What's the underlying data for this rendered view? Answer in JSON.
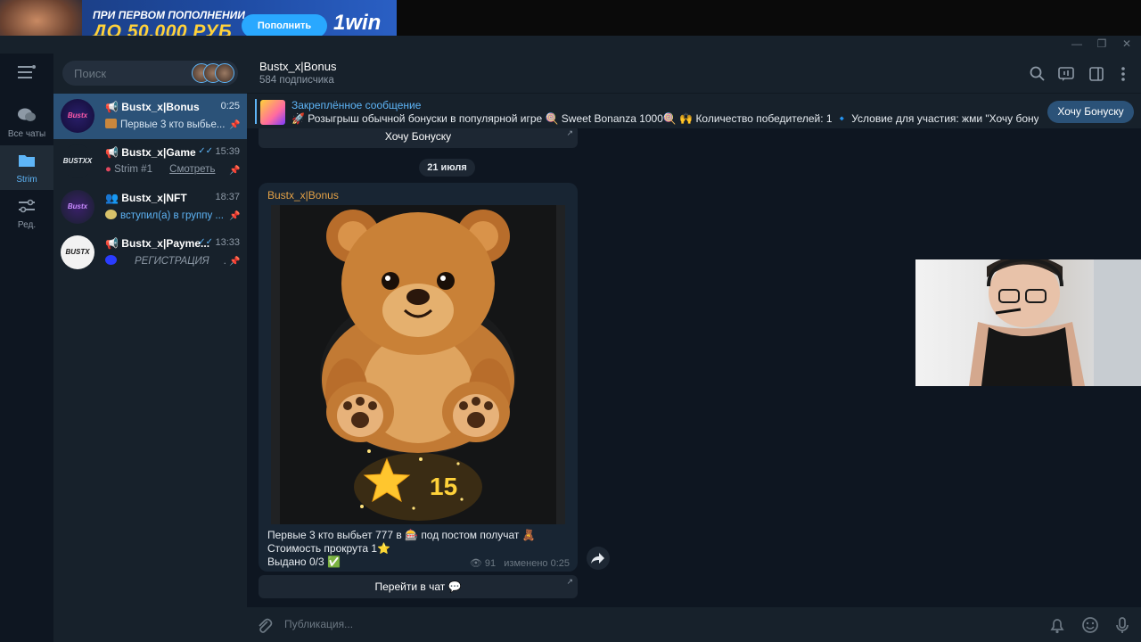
{
  "ad": {
    "line1": "ПРИ ПЕРВОМ ПОПОЛНЕНИИ",
    "line2": "ДО 50.000 РУБ",
    "button": "Пополнить",
    "logo": "1win"
  },
  "rail": {
    "items": [
      {
        "label": "Все чаты",
        "icon": "chats-icon"
      },
      {
        "label": "Strim",
        "icon": "folder-icon"
      },
      {
        "label": "Ред.",
        "icon": "edit-filters-icon"
      }
    ]
  },
  "search": {
    "placeholder": "Поиск"
  },
  "chats": [
    {
      "name": "Bustx_x|Bonus",
      "time": "0:25",
      "preview": "Первые 3 кто выбье...",
      "avatar_text": "Bustx BONUS"
    },
    {
      "name": "Bustx_x|Game",
      "time": "15:39",
      "preview": "Strim #1",
      "action": "Смотреть",
      "avatar_text": "BUSTXX"
    },
    {
      "name": "Bustx_x|NFT",
      "time": "18:37",
      "preview": "вступил(а) в группу ...",
      "avatar_text": "Bustx NFT"
    },
    {
      "name": "Bustx_x|Payme...",
      "time": "13:33",
      "preview": "РЕГИСТРАЦИЯ",
      "preview_tail": "...",
      "avatar_text": "BUSTX"
    }
  ],
  "header": {
    "title": "Bustx_x|Bonus",
    "subtitle": "584 подписчика"
  },
  "pinned": {
    "title": "Закреплённое сообщение",
    "text": "🚀 Розыгрыш обычной бонуски в популярной игре 🍭 Sweet Bonanza 1000🍭 🙌 Количество победителей: 1 🔹 Условие для участия: жми \"Хочу бонуску\" 🔘...",
    "button": "Хочу Бонуску"
  },
  "messages": {
    "top_button": "Хочу Бонуску",
    "date": "21 июля",
    "sender": "Bustx_x|Bonus",
    "badge_value": "15",
    "lines": [
      "Первые 3 кто выбьет 777 в 🎰 под постом получат 🧸",
      "Стоимость прокрута 1⭐",
      "Выдано 0/3 ✅"
    ],
    "views": "91",
    "edited": "изменено 0:25",
    "bottom_button": "Перейти в чат 💬"
  },
  "composer": {
    "placeholder": "Публикация..."
  },
  "colors": {
    "accent": "#5eb5f7",
    "active_chat": "#2b5278",
    "sender": "#e3a146",
    "background": "#0e1621",
    "panel": "#17212b"
  }
}
